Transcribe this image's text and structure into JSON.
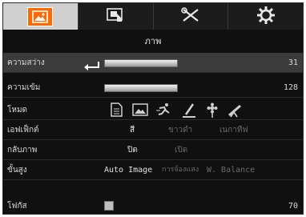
{
  "tabs": [
    {
      "name": "picture-tab",
      "icon": "picture-icon",
      "active": true
    },
    {
      "name": "display-tab",
      "icon": "display-icon",
      "active": false
    },
    {
      "name": "tools-tab",
      "icon": "tools-icon",
      "active": false
    },
    {
      "name": "settings-tab",
      "icon": "gear-icon",
      "active": false
    }
  ],
  "page_title": "ภาพ",
  "rows": {
    "brightness": {
      "label": "ความสว่าง",
      "value": "31"
    },
    "contrast": {
      "label": "ความเข้ม",
      "value": "128"
    },
    "mode": {
      "label": "โหมด",
      "icons": [
        "document-icon",
        "picture-icon",
        "sport-icon",
        "sketch-icon",
        "macro-icon",
        "microscope-icon"
      ]
    },
    "effect": {
      "label": "เอฟเฟ็กต์",
      "options": [
        "สี",
        "ขาวดำ",
        "เนกาทีฟ"
      ]
    },
    "flip": {
      "label": "กลับภาพ",
      "options": [
        "ปิด",
        "เปิด"
      ]
    },
    "advanced": {
      "label": "ขั้นสูง",
      "options": [
        "Auto Image",
        "การจ้องแสง",
        "W. Balance"
      ]
    },
    "focus": {
      "label": "โฟกัส",
      "value": "70"
    }
  },
  "colors": {
    "accent": "#ff6a00",
    "selected_row": "#3b3b3b"
  }
}
